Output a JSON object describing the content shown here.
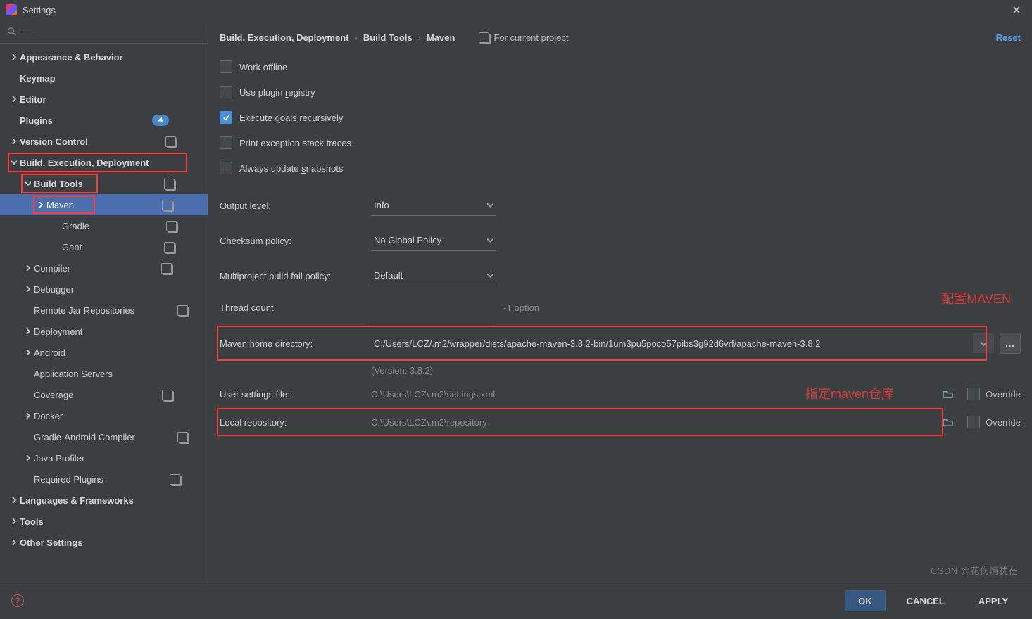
{
  "window": {
    "title": "Settings"
  },
  "breadcrumbs": {
    "items": [
      "Build, Execution, Deployment",
      "Build Tools",
      "Maven"
    ],
    "scope": "For current project",
    "reset": "Reset"
  },
  "sidebar": {
    "badge_plugins": "4",
    "items": {
      "appearance": "Appearance & Behavior",
      "keymap": "Keymap",
      "editor": "Editor",
      "plugins": "Plugins",
      "vcs": "Version Control",
      "bed": "Build, Execution, Deployment",
      "build_tools": "Build Tools",
      "maven": "Maven",
      "gradle": "Gradle",
      "gant": "Gant",
      "compiler": "Compiler",
      "debugger": "Debugger",
      "remote_jar": "Remote Jar Repositories",
      "deployment": "Deployment",
      "android": "Android",
      "app_servers": "Application Servers",
      "coverage": "Coverage",
      "docker": "Docker",
      "gac": "Gradle-Android Compiler",
      "jprof": "Java Profiler",
      "req_plugins": "Required Plugins",
      "lang_fw": "Languages & Frameworks",
      "tools": "Tools",
      "other": "Other Settings"
    }
  },
  "form": {
    "work_offline": "Work offline",
    "use_plugin_registry": "Use plugin registry",
    "exec_goals": "Execute goals recursively",
    "print_trace": "Print exception stack traces",
    "always_update": "Always update snapshots",
    "output_level_lbl": "Output level:",
    "output_level_val": "Info",
    "checksum_lbl": "Checksum policy:",
    "checksum_val": "No Global Policy",
    "multiproj_lbl": "Multiproject build fail policy:",
    "multiproj_val": "Default",
    "thread_lbl": "Thread count",
    "t_opt": "-T option",
    "home_lbl": "Maven home directory:",
    "home_val": "C:/Users/LCZ/.m2/wrapper/dists/apache-maven-3.8.2-bin/1um3pu5poco57pibs3g92d6vrf/apache-maven-3.8.2",
    "dots": "...",
    "version": "(Version: 3.8.2)",
    "user_settings_lbl": "User settings file:",
    "user_settings_val": "C:\\Users\\LCZ\\.m2\\settings.xml",
    "local_repo_lbl": "Local repository:",
    "local_repo_val": "C:\\Users\\LCZ\\.m2\\repository",
    "override": "Override"
  },
  "annotations": {
    "a1": "配置MAVEN",
    "a2": "指定maven仓库"
  },
  "buttons": {
    "ok": "OK",
    "cancel": "CANCEL",
    "apply": "APPLY"
  },
  "watermark": "CSDN @花伤情犹在"
}
